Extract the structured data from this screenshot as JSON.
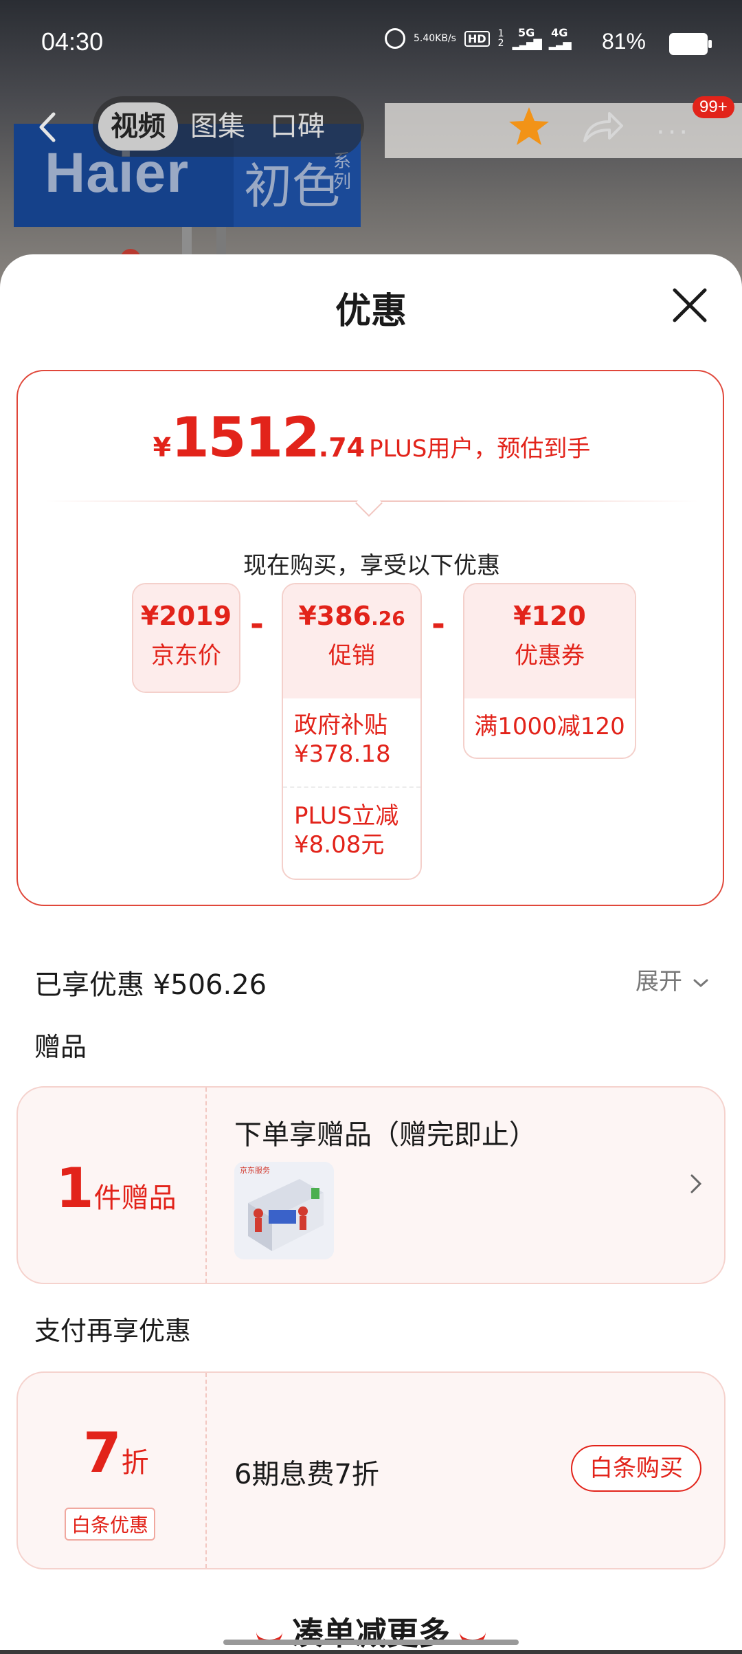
{
  "status_bar": {
    "time": "04:30",
    "net_speed_value": "5.40",
    "net_speed_unit": "KB/s",
    "hd_label": "HD",
    "sim_slot_top": "1",
    "sim_slot_bottom": "2",
    "network_5g": "5G",
    "network_4g": "4G",
    "battery_percent": "81%"
  },
  "nav": {
    "tabs": [
      "视频",
      "图集",
      "口碑"
    ],
    "active_tab": "视频",
    "more_badge": "99+"
  },
  "background": {
    "brand": "Haier",
    "series": "初色",
    "series_suffix": "系列"
  },
  "sheet": {
    "title": "优惠"
  },
  "estimate": {
    "currency": "¥",
    "price_int": "1512",
    "price_dec": ".74",
    "label": "PLUS用户，预估到手"
  },
  "breakdown": {
    "intro": "现在购买，享受以下优惠",
    "jd_price": {
      "amount": "¥2019",
      "label": "京东价"
    },
    "promo": {
      "amount_int": "¥386",
      "amount_dec": ".26",
      "label": "促销",
      "items": [
        "政府补贴 ¥378.18",
        "PLUS立减 ¥8.08元"
      ]
    },
    "coupon": {
      "amount": "¥120",
      "label": "优惠券",
      "items": [
        "满1000减120"
      ]
    },
    "operator": "-"
  },
  "savings": {
    "label": "已享优惠 ¥506.26",
    "expand": "展开"
  },
  "gifts": {
    "section_title": "赠品",
    "count": "1",
    "count_unit": "件赠品",
    "title": "下单享赠品（赠完即止）",
    "image_caption": "京东服务"
  },
  "payment": {
    "section_title": "支付再享优惠",
    "discount": "7",
    "discount_unit": "折",
    "tag": "白条优惠",
    "description": "6期息费7折",
    "button": "白条购买"
  },
  "footer": {
    "more_label": "凑单减更多"
  },
  "colors": {
    "accent": "#e2231a",
    "card_bg": "#fdf5f4",
    "border": "#f5d2cd"
  }
}
